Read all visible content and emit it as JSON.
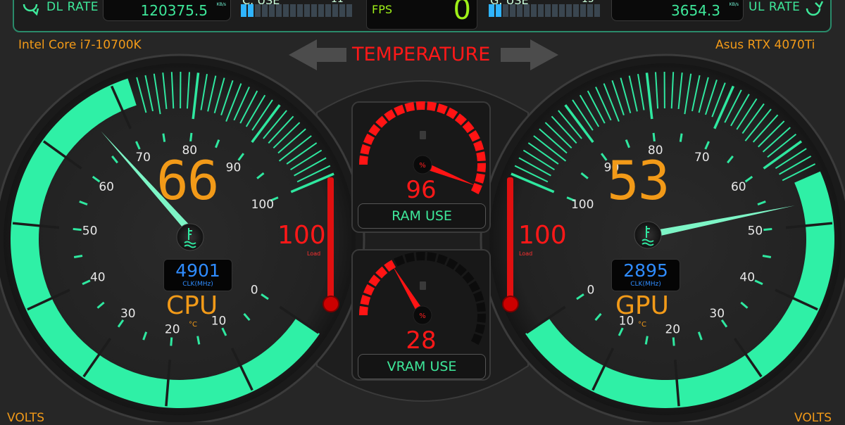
{
  "header": {
    "dl_label": "DL RATE",
    "dl_value": "120375.5",
    "dl_unit": "KB/s",
    "cpu_use_label": "C. USE",
    "cpu_use_value": "11",
    "fps_label": "FPS",
    "fps_value": "0",
    "gpu_use_label": "G. USE",
    "gpu_use_value": "15",
    "ul_value": "3654.3",
    "ul_unit": "KB/s",
    "ul_label": "UL RATE"
  },
  "cpu_model": "Intel Core i7-10700K",
  "gpu_model": "Asus RTX 4070Ti",
  "title": "TEMPERATURE",
  "cpu": {
    "temp": "66",
    "temp_value": 66,
    "clock": "4901",
    "clock_unit": "CLK(MHz)",
    "name": "CPU",
    "unit": "°C",
    "load": "100",
    "load_value": 100,
    "load_label": "Load",
    "ticks": [
      "0",
      "10",
      "20",
      "30",
      "40",
      "50",
      "60",
      "70",
      "80",
      "90",
      "100"
    ]
  },
  "gpu": {
    "temp": "53",
    "temp_value": 53,
    "clock": "2895",
    "clock_unit": "CLK(MHz)",
    "name": "GPU",
    "unit": "°C",
    "load": "100",
    "load_value": 100,
    "load_label": "Load",
    "ticks": [
      "0",
      "10",
      "20",
      "30",
      "40",
      "50",
      "60",
      "70",
      "80",
      "90",
      "100"
    ]
  },
  "ram": {
    "value": "96",
    "value_num": 96,
    "label": "RAM USE",
    "pct_symbol": "%"
  },
  "vram": {
    "value": "28",
    "value_num": 28,
    "label": "VRAM USE",
    "pct_symbol": "%"
  },
  "volts_label": "VOLTS",
  "colors": {
    "accent": "#2fe8a0",
    "orange": "#f29a18",
    "red": "#ff1818",
    "blue": "#2f8cff"
  },
  "icons": {
    "dl": "download-arrow-icon",
    "ul": "upload-arrow-icon",
    "temp": "thermometer-icon",
    "fuel": "fuel-pump-icon"
  }
}
